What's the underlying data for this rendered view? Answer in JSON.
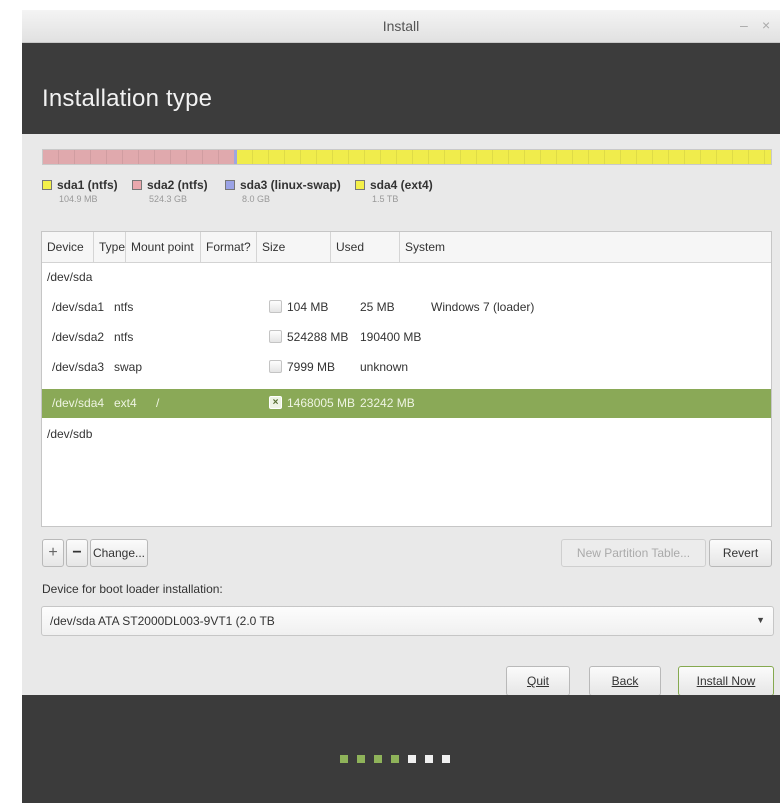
{
  "window": {
    "title": "Install",
    "minimize_glyph": "–",
    "close_glyph": "×"
  },
  "header": {
    "title": "Installation type"
  },
  "partition_bar": {
    "segments": [
      {
        "name": "sda1",
        "fraction": 0.0001,
        "color": "#e0a9ad"
      },
      {
        "name": "sda2",
        "fraction": 0.262,
        "color": "#e0a9ad"
      },
      {
        "name": "sda3",
        "fraction": 0.004,
        "color": "#9fa6e0"
      },
      {
        "name": "sda4",
        "fraction": 0.734,
        "color": "#f0ec4c"
      }
    ]
  },
  "legend": [
    {
      "label": "sda1 (ntfs)",
      "size": "104.9 MB",
      "color": "#f4f04a"
    },
    {
      "label": "sda2 (ntfs)",
      "size": "524.3 GB",
      "color": "#eaa8ad"
    },
    {
      "label": "sda3 (linux-swap)",
      "size": "8.0 GB",
      "color": "#9ba3e6"
    },
    {
      "label": "sda4 (ext4)",
      "size": "1.5 TB",
      "color": "#f4f04a"
    }
  ],
  "table": {
    "headers": [
      "Device",
      "Type",
      "Mount point",
      "Format?",
      "Size",
      "Used",
      "System"
    ],
    "rows": [
      {
        "device": "/dev/sda",
        "type": "",
        "mount": "",
        "format": "",
        "size": "",
        "used": "",
        "system": ""
      },
      {
        "device": "/dev/sda1",
        "type": "ntfs",
        "mount": "",
        "format": "",
        "size": "104 MB",
        "used": "25 MB",
        "system": "Windows 7 (loader)"
      },
      {
        "device": "/dev/sda2",
        "type": "ntfs",
        "mount": "",
        "format": "",
        "size": "524288 MB",
        "used": "190400 MB",
        "system": ""
      },
      {
        "device": "/dev/sda3",
        "type": "swap",
        "mount": "",
        "format": "",
        "size": "7999 MB",
        "used": "unknown",
        "system": ""
      },
      {
        "device": "/dev/sda4",
        "type": "ext4",
        "mount": "/",
        "format": "×",
        "size": "1468005 MB",
        "used": "23242 MB",
        "system": ""
      },
      {
        "device": "/dev/sdb",
        "type": "",
        "mount": "",
        "format": "",
        "size": "",
        "used": "",
        "system": ""
      }
    ]
  },
  "toolbar": {
    "add": "+",
    "remove": "−",
    "change": "Change...",
    "new_partition_table": "New Partition Table...",
    "revert": "Revert"
  },
  "boot": {
    "label": "Device for boot loader installation:",
    "value": "/dev/sda   ATA ST2000DL003-9VT1 (2.0 TB",
    "arrow": "▼"
  },
  "actions": {
    "quit": "Quit",
    "back": "Back",
    "install": "Install Now"
  },
  "progress": {
    "total_steps": 7,
    "completed_steps": 4,
    "done_color": "#8fb35a",
    "todo_color": "#f0f0f0"
  }
}
